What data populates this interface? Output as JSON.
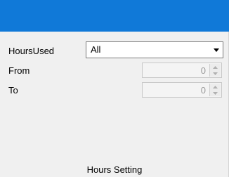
{
  "panel": {
    "title_bar_color": "#1079d8",
    "footer_label": "Hours Setting"
  },
  "hours_used": {
    "label": "HoursUsed",
    "selected": "All",
    "arrow_icon": "chevron-down-icon"
  },
  "from": {
    "label": "From",
    "value": "0"
  },
  "to": {
    "label": "To",
    "value": "0"
  }
}
